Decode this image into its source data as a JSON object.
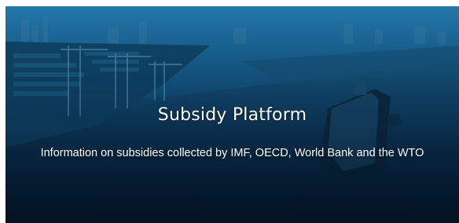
{
  "hero": {
    "title": "Subsidy Platform",
    "subtitle": "Information on subsidies collected by IMF, OECD, World Bank and the WTO",
    "background_image": "port-with-container-ship-photo"
  }
}
